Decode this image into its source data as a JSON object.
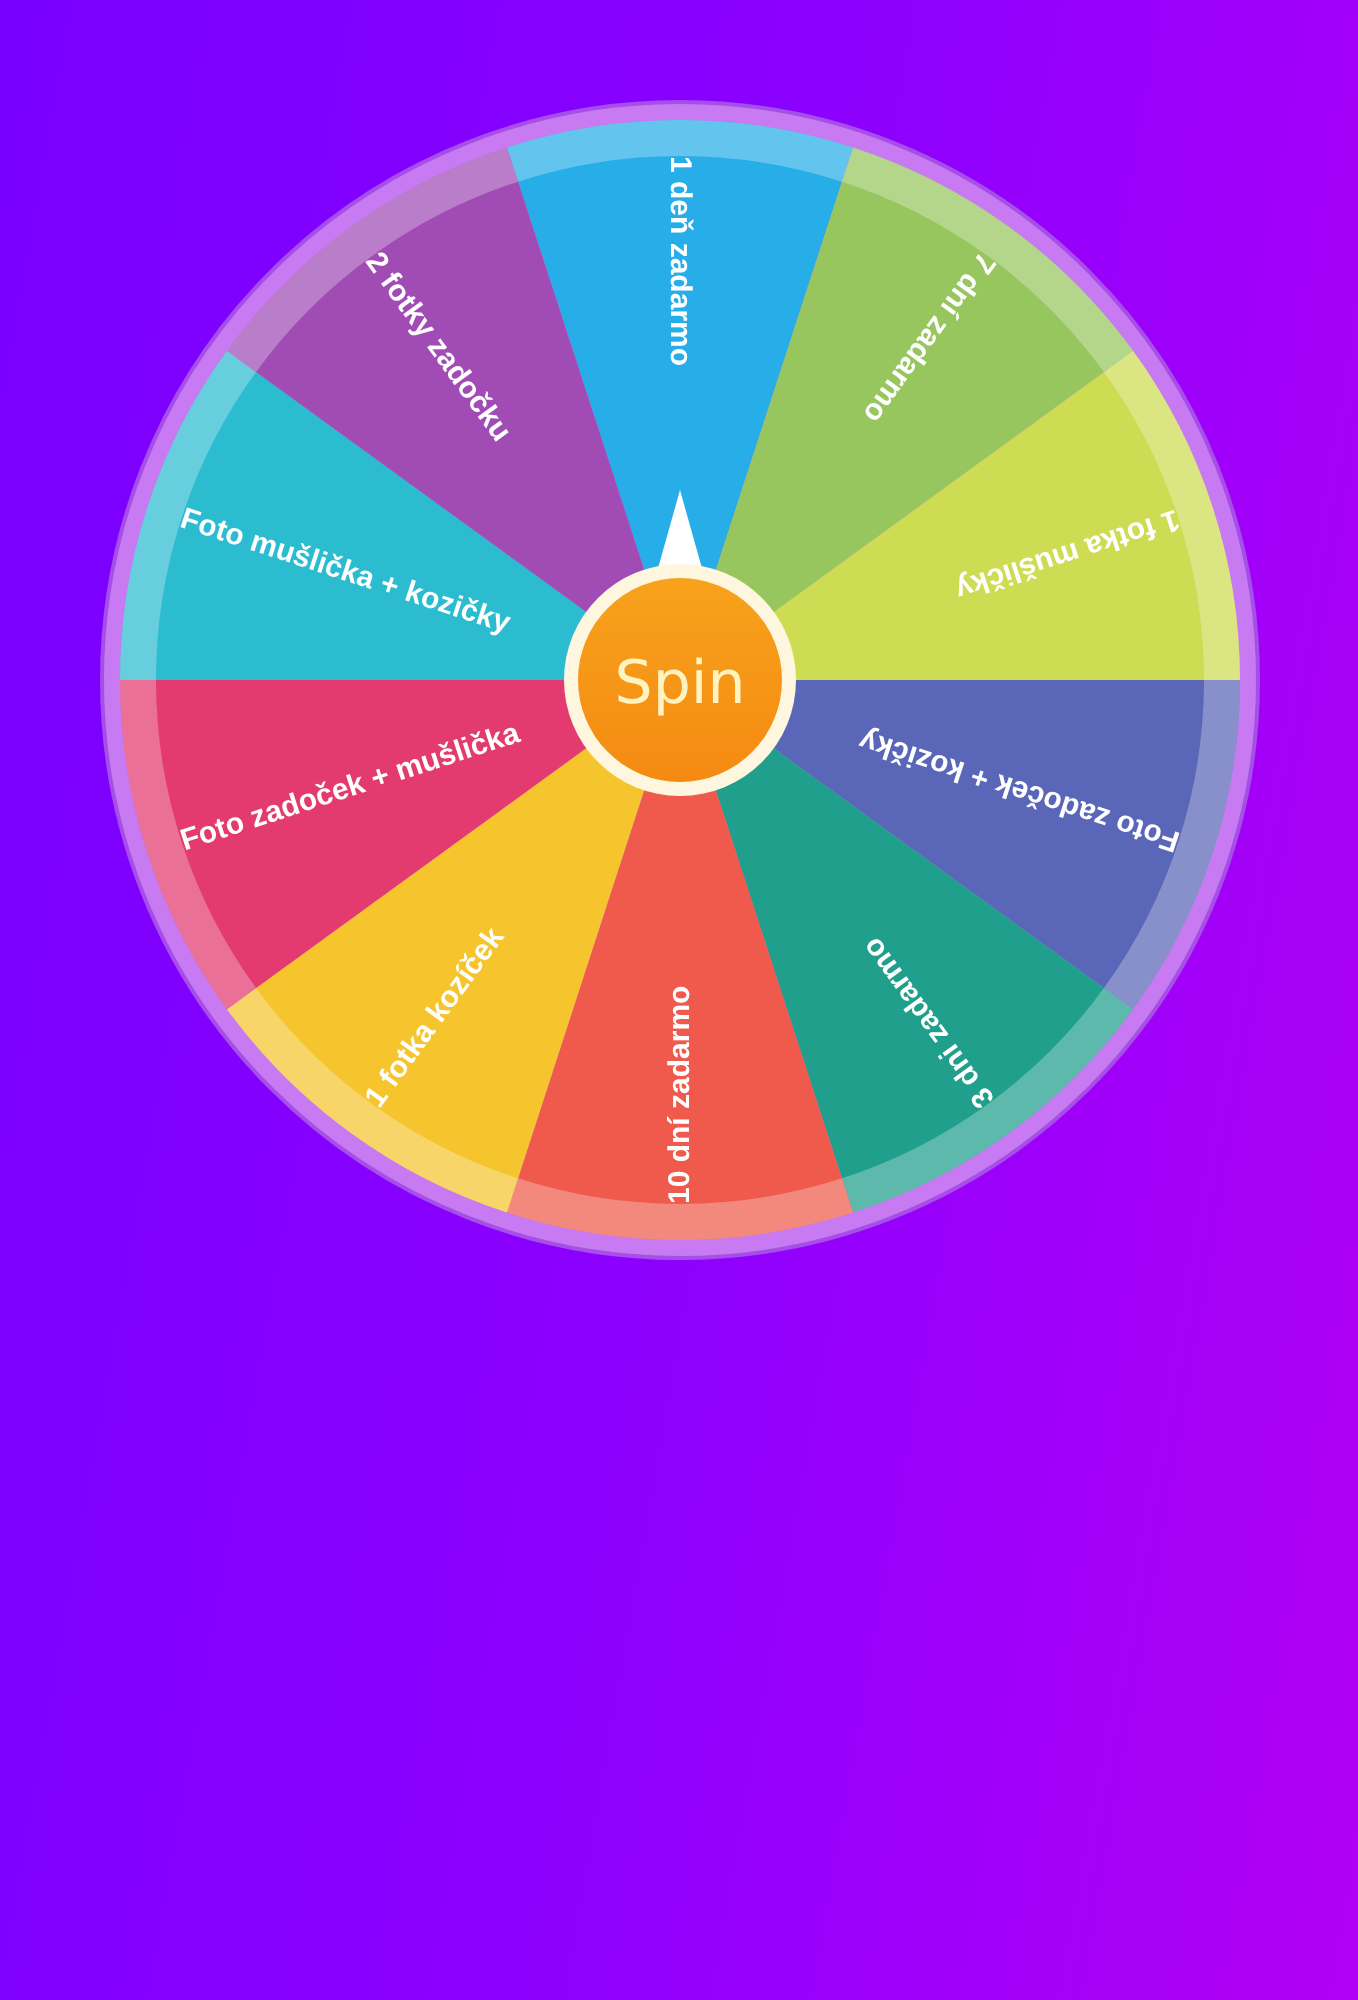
{
  "wheel": {
    "segments": [
      {
        "label": "1 deň zadarmo",
        "color": "#27aee8"
      },
      {
        "label": "7 dní zadarmo",
        "color": "#97c65e"
      },
      {
        "label": "1 fotka mušličky",
        "color": "#cddc52"
      },
      {
        "label": "Foto zadoček + kozičky",
        "color": "#5a66b8"
      },
      {
        "label": "3 dni zadarmo",
        "color": "#1f9f8c"
      },
      {
        "label": "10 dní zadarmo",
        "color": "#ef5a4c"
      },
      {
        "label": "1 fotka kozíček",
        "color": "#f6c52e"
      },
      {
        "label": "Foto zadoček + mušlička",
        "color": "#e33a6f"
      },
      {
        "label": "Foto mušlička + kozičky",
        "color": "#2bbcd0"
      },
      {
        "label": "2 fotky zadočku",
        "color": "#a04cb4"
      }
    ],
    "button": "Spin"
  }
}
